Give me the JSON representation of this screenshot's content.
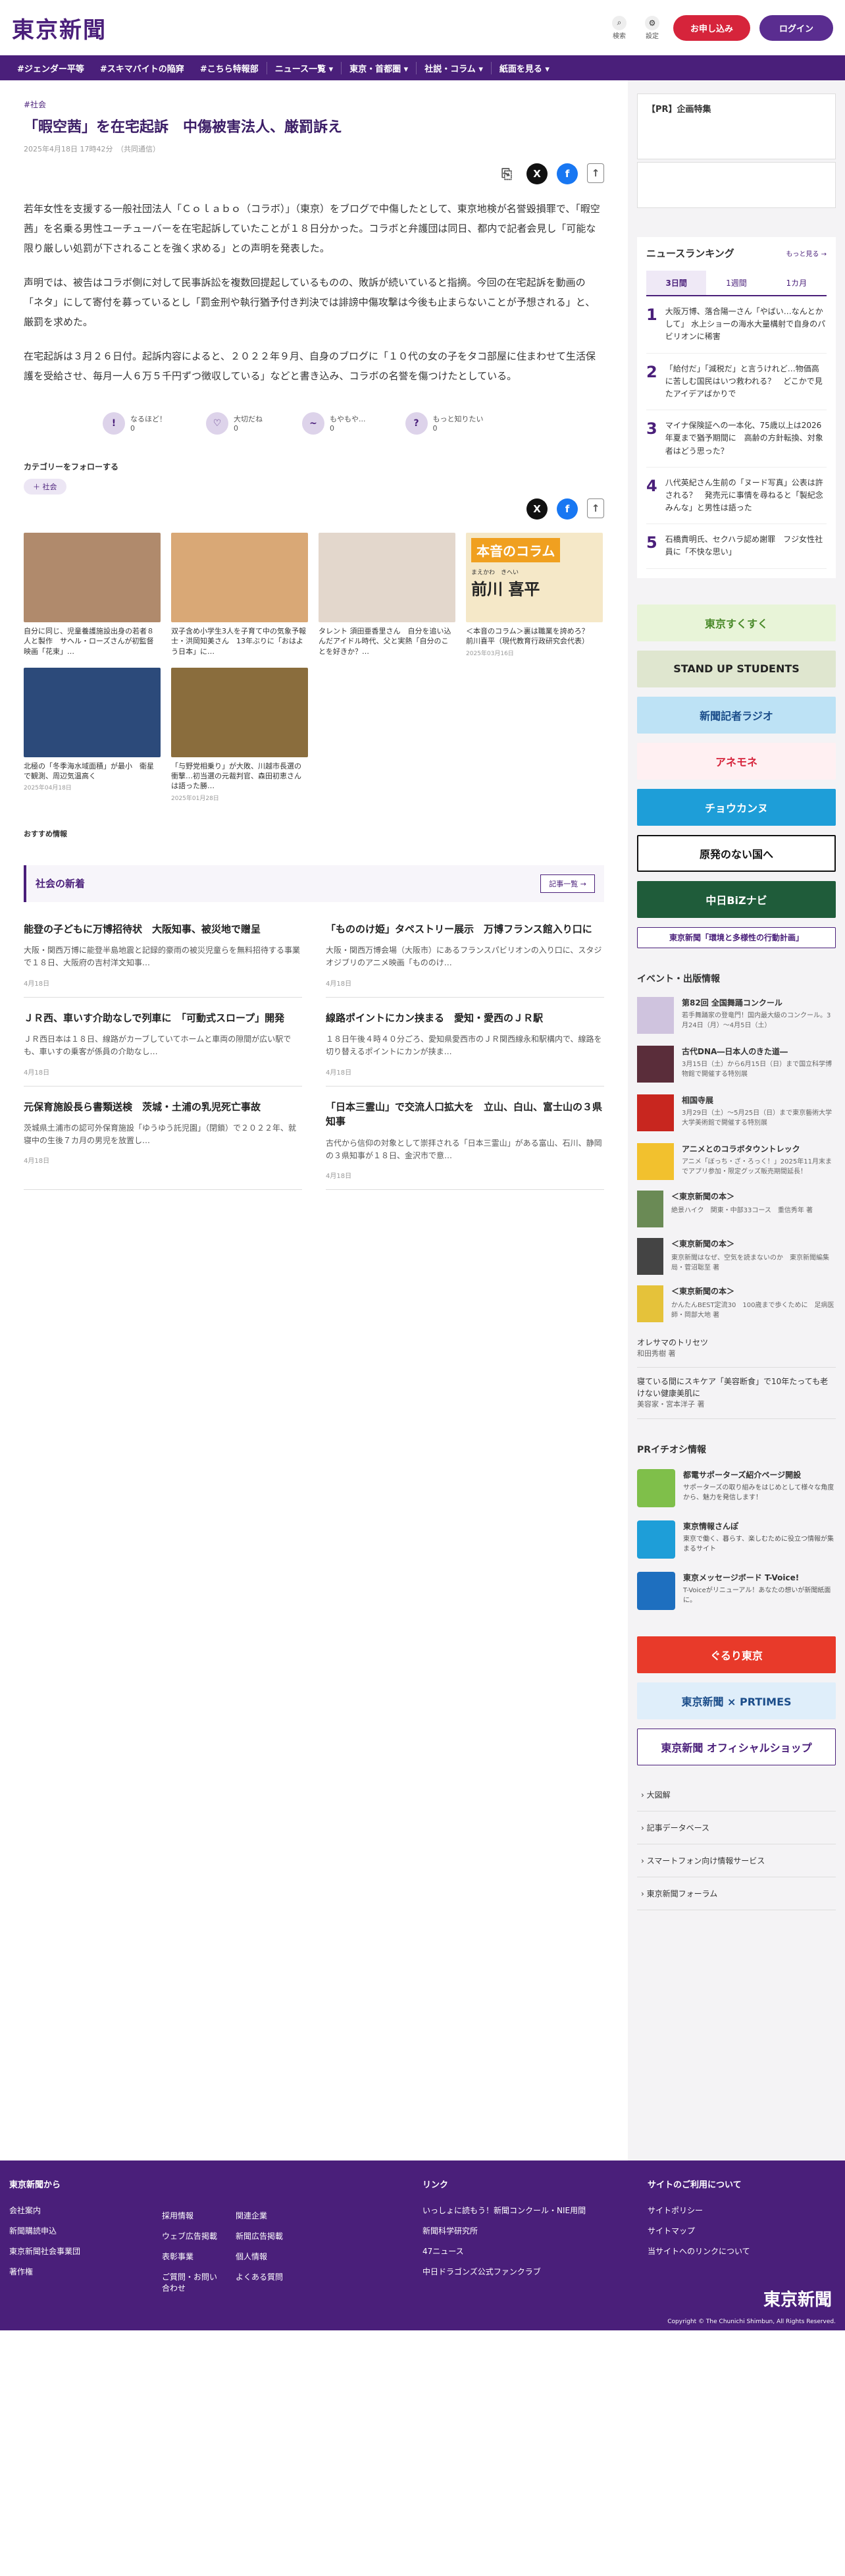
{
  "header": {
    "logo": "東京新聞",
    "search": "検索",
    "settings": "設定",
    "subscribe": "お申し込み",
    "login": "ログイン"
  },
  "nav": [
    "#ジェンダー平等",
    "#スキマバイトの陥穽",
    "#こちら特報部",
    "ニュース一覧 ▾",
    "東京・首都圏 ▾",
    "社説・コラム ▾",
    "紙面を見る ▾"
  ],
  "article": {
    "tag": "#社会",
    "title": "「暇空茜」を在宅起訴　中傷被害法人、厳罰訴え",
    "date": "2025年4月18日 17時42分　（共同通信）",
    "paragraphs": [
      "若年女性を支援する一般社団法人「Ｃｏｌａｂｏ（コラボ）」（東京）をブログで中傷したとして、東京地検が名誉毀損罪で、「暇空茜」を名乗る男性ユーチューバーを在宅起訴していたことが１８日分かった。コラボと弁護団は同日、都内で記者会見し「可能な限り厳しい処罰が下されることを強く求める」との声明を発表した。",
      "声明では、被告はコラボ側に対して民事訴訟を複数回提起しているものの、敗訴が続いていると指摘。今回の在宅起訴を動画の「ネタ」にして寄付を募っているとし「罰金刑や執行猶予付き判決では誹謗中傷攻撃は今後も止まらないことが予想される」と、厳罰を求めた。",
      "在宅起訴は３月２６日付。起訴内容によると、２０２２年９月、自身のブログに「１０代の女の子をタコ部屋に住まわせて生活保護を受給させ、毎月一人６万５千円ずつ徴収している」などと書き込み、コラボの名誉を傷つけたとしている。"
    ]
  },
  "reactions": [
    {
      "label": "なるほど！",
      "count": "0",
      "icon": "!"
    },
    {
      "label": "大切だね",
      "count": "0",
      "icon": "♡"
    },
    {
      "label": "もやもや...",
      "count": "0",
      "icon": "~"
    },
    {
      "label": "もっと知りたい",
      "count": "0",
      "icon": "?"
    }
  ],
  "follow": {
    "heading": "カテゴリーをフォローする",
    "chip": "＋ 社会"
  },
  "related": [
    {
      "caption": "自分に同じ、児童養護施設出身の若者８人と製作　サヘル・ローズさんが初監督映画「花束」…",
      "date": "",
      "color": "#b08a6c"
    },
    {
      "caption": "双子含め小学生3人を子育て中の気象予報士・洪岡知美さん　13年ぶりに「おはよう日本」に…",
      "date": "",
      "color": "#d9a876"
    },
    {
      "caption": "タレント 須田亜香里さん　自分を追い込んだアイドル時代、父と実熱「自分のことを好きか？…",
      "date": "",
      "color": "#e3d7cc"
    },
    {
      "caption": "＜本音のコラム＞裏は職業を誇めろ？　前川喜平（現代教育行政研究会代表）",
      "date": "2025年03月16日",
      "color": "#f5e8c8"
    },
    {
      "caption": "北極の「冬季海水域面積」が最小　衛星で観測、周辺気温高く",
      "date": "2025年04月18日",
      "color": "#2c4a7a"
    },
    {
      "caption": "「与野党相乗り」が大敗、川越市長選の衝撃…初当選の元裁判官、森田初恵さんは語った勝…",
      "date": "2025年01月28日",
      "color": "#8a6d3d"
    }
  ],
  "column_badge": {
    "title": "本音のコラム",
    "name": "前川 喜平",
    "reading": "まえかわ　きへい"
  },
  "recommend_label": "おすすめ情報",
  "news": {
    "title": "社会の新着",
    "more": "記事一覧 →",
    "items": [
      {
        "h": "能登の子どもに万博招待状　大阪知事、被災地で贈呈",
        "s": "大阪・関西万博に能登半島地震と記録的豪雨の被災児童らを無料招待する事業で１８日、大阪府の吉村洋文知事…",
        "d": "4月18日"
      },
      {
        "h": "「もののけ姫」タペストリー展示　万博フランス館入り口に",
        "s": "大阪・関西万博会場（大阪市）にあるフランスパビリオンの入り口に、スタジオジブリのアニメ映画「もののけ…",
        "d": "4月18日"
      },
      {
        "h": "ＪＲ西、車いす介助なしで列車に　「可動式スロープ」開発",
        "s": "ＪＲ西日本は１８日、線路がカーブしていてホームと車両の隙間が広い駅でも、車いすの乗客が係員の介助なし…",
        "d": "4月18日"
      },
      {
        "h": "線路ポイントにカン挟まる　愛知・愛西のＪＲ駅",
        "s": "１８日午後４時４０分ごろ、愛知県愛西市のＪＲ関西線永和駅構内で、線路を切り替えるポイントにカンが挟ま…",
        "d": "4月18日"
      },
      {
        "h": "元保育施設長ら書類送検　茨城・土浦の乳児死亡事故",
        "s": "茨城県土浦市の認可外保育施設「ゆうゆう託児園」（閉鎖）で２０２２年、就寝中の生後７カ月の男児を放置し…",
        "d": "4月18日"
      },
      {
        "h": "「日本三霊山」で交流人口拡大を　立山、白山、富士山の３県知事",
        "s": "古代から信仰の対象として崇拝される「日本三霊山」がある富山、石川、静岡の３県知事が１８日、金沢市で意…",
        "d": "4月18日"
      }
    ]
  },
  "side": {
    "pr_title": "【PR】企画特集",
    "ranking": {
      "title": "ニュースランキング",
      "more": "もっと見る →",
      "tabs": [
        "3日間",
        "1週間",
        "1カ月"
      ],
      "items": [
        {
          "n": "1",
          "t": "大阪万博、落合陽一さん「やばい…なんとかして」 水上ショーの海水大量構射で自身のパビリオンに稀害"
        },
        {
          "n": "2",
          "t": "「給付だ」「減税だ」と言うけれど…物価高に苦しむ国民はいつ救われる？　どこかで見たアイデアばかりで"
        },
        {
          "n": "3",
          "t": "マイナ保険証への一本化、75歳以上は2026年夏まで猶予期間に　高齢の方針転換、対象者はどう思った？"
        },
        {
          "n": "4",
          "t": "八代英紀さん生前の「ヌード写真」公表は許される？　発売元に事情を尋ねると「製紀念みんな」と男性は語った"
        },
        {
          "n": "5",
          "t": "石橋貴明氏、セクハラ認め謝罪　フジ女性社員に「不快な思い」"
        }
      ]
    },
    "banners": [
      {
        "t": "東京すくすく",
        "bg": "#e8f4d8",
        "fg": "#4a8a2a",
        "small": false
      },
      {
        "t": "STAND UP STUDENTS",
        "bg": "#dfe6cf",
        "fg": "#222",
        "small": false
      },
      {
        "t": "新聞記者ラジオ",
        "bg": "#bde2f5",
        "fg": "#1b4d8a",
        "small": false
      },
      {
        "t": "アネモネ",
        "bg": "#fff0f2",
        "fg": "#d6243b",
        "small": false
      },
      {
        "t": "チョウカンヌ",
        "bg": "#1e9ed8",
        "fg": "#fff",
        "small": false
      },
      {
        "t": "原発のない国へ",
        "bg": "#fff",
        "fg": "#111",
        "small": false
      },
      {
        "t": "中日BiZナビ",
        "bg": "#1f5c3a",
        "fg": "#fff",
        "small": false
      },
      {
        "t": "東京新聞「環境と多様性の行動計画」",
        "bg": "#fff",
        "fg": "#4a1f7a",
        "small": true
      }
    ],
    "events_title": "イベント・出版情報",
    "events": [
      {
        "h": "第82回 全国舞踊コンクール",
        "s": "若手舞踊家の登竜門！国内最大級のコンクール。3月24日（月）〜4月5日（土）",
        "c": "#cfc3de"
      },
      {
        "h": "古代DNA―日本人のきた道―",
        "s": "3月15日（土）から6月15日（日）まで国立科学博物館で開催する特別展",
        "c": "#5a2d3a"
      },
      {
        "h": "相国寺展",
        "s": "3月29日（土）〜5月25日（日）まで東京藝術大学大学美術館で開催する特別展",
        "c": "#c8261f"
      },
      {
        "h": "アニメとのコラボタウントレック",
        "s": "アニメ「ぼっち・ざ・ろっく！」2025年11月末までアプリ参加・限定グッズ販売期間延長！",
        "c": "#f2c12e"
      }
    ],
    "books": [
      {
        "h": "＜東京新聞の本＞",
        "s": "絶景ハイク　関東・中部33コース　重信秀年 著",
        "c": "#6a8a55"
      },
      {
        "h": "＜東京新聞の本＞",
        "s": "東京新聞はなぜ、空気を読まないのか　東京新聞編集局・菅沼聡至 著",
        "c": "#444"
      },
      {
        "h": "＜東京新聞の本＞",
        "s": "かんたんBEST定流30　100歳まで歩くために　足病医師・岡部大地 著",
        "c": "#e5c23a"
      }
    ],
    "links": [
      {
        "t": "オレサマのトリセツ",
        "s": "和田秀樹 著"
      },
      {
        "t": "寝ている間にスキケア「美容断食」で10年たっても老けない健康美肌に",
        "s": "美容家・宮本洋子 著"
      }
    ],
    "pr_info_title": "PRイチオシ情報",
    "pr_info": [
      {
        "h": "都電サポーターズ紹介ページ開設",
        "s": "サポーターズの取り組みをはじめとして様々な角度から、魅力を発信します！",
        "c": "#7fbf4a"
      },
      {
        "h": "東京情報さんぽ",
        "s": "東京で働く、暮らす、楽しむために役立つ情報が集まるサイト",
        "c": "#1e9ed8"
      },
      {
        "h": "東京メッセージボード T-Voice!",
        "s": "T-Voiceがリニューアル！あなたの想いが新聞紙面に。",
        "c": "#1e6fbf"
      }
    ],
    "banners2": [
      {
        "t": "ぐるり東京",
        "bg": "#e83a2a",
        "fg": "#fff"
      },
      {
        "t": "東京新聞 × PRTIMES",
        "bg": "#dfeefa",
        "fg": "#1b4d8a"
      },
      {
        "t": "東京新聞 オフィシャルショップ",
        "bg": "#fff",
        "fg": "#4a1f7a"
      }
    ],
    "site_links": [
      "大図解",
      "記事データベース",
      "スマートフォン向け情報サービス",
      "東京新聞フォーラム"
    ]
  },
  "footer": {
    "col1_title": "東京新聞から",
    "col1": [
      "会社案内",
      "新聞購読申込",
      "東京新聞社会事業団",
      "著作権"
    ],
    "col2": [
      "採用情報",
      "ウェブ広告掲載",
      "表彰事業",
      "ご質問・お問い合わせ"
    ],
    "col3": [
      "関連企業",
      "新聞広告掲載",
      "個人情報",
      "よくある質問"
    ],
    "col4_title": "リンク",
    "col4": [
      "いっしょに読もう！新聞コンクール・NIE用間",
      "新聞科学研究所",
      "47ニュース",
      "中日ドラゴンズ公式ファンクラブ"
    ],
    "col5_title": "サイトのご利用について",
    "col5": [
      "サイトポリシー",
      "サイトマップ",
      "当サイトへのリンクについて"
    ],
    "logo": "東京新聞",
    "copyright": "Copyright © The Chunichi Shimbun, All Rights Reserved."
  },
  "colors": {
    "brand": "#4a1f7a",
    "accent": "#d6243b"
  }
}
